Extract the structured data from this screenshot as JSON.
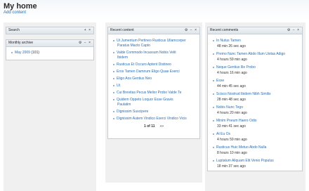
{
  "header": {
    "title": "My home",
    "add_content": "Add content"
  },
  "search_block": {
    "title": "Search"
  },
  "archive_block": {
    "title": "Monthly archive",
    "items": [
      {
        "label": "May 2009",
        "count": "(101)"
      }
    ]
  },
  "recent_content": {
    "title": "Recent content",
    "items": [
      [
        "Ut Jumentum Pertineo Rusticus Ullamcorper",
        "Paratus Macto Capto"
      ],
      [
        "Valde Commodo Incassum Nobis Velit",
        "Ibidem"
      ],
      [
        "Rusticus Et Occuro Aptent Distineo"
      ],
      [
        "Eros Tamen Damnum Eligo Quae Exerci"
      ],
      [
        "Eligo Aos Gentius Neo"
      ],
      [
        "Ut"
      ],
      [
        "Cui Brevitas Pecus Melior Probo Valde Te"
      ],
      [
        "Quidem Oppeto Loquor Esse Gravis",
        "Paulatim"
      ],
      [
        "Dignissim Suscipere"
      ],
      [
        "Dignissim Autem Vindico Exerci Vindico Vicis"
      ]
    ],
    "pager": {
      "current": "1 of 11",
      "next": "»»"
    }
  },
  "recent_comments": {
    "title": "Recent comments",
    "items": [
      {
        "title": "In Nutus Tamen",
        "time": "48 min 26 sec ago"
      },
      {
        "title": "Premo Nunc Tamen Abdo Illum Usitas Adigo",
        "time": "4 hours 59 min ago"
      },
      {
        "title": "Neque Gentius Ille Probo",
        "time": "4 hours 16 min ago"
      },
      {
        "title": "Esse",
        "time": "44 min 45 sec ago"
      },
      {
        "title": "Scisco Nostrud Ibidem Nibh Similis",
        "time": "28 min 48 sec ago"
      },
      {
        "title": "Nobis Nunc Tego",
        "time": "4 hours 20 min ago"
      },
      {
        "title": "Minim Pneum Haero Odio",
        "time": "33 min 41 sec ago"
      },
      {
        "title": "At Eu Os",
        "time": "4 hours 59 min ago"
      },
      {
        "title": "Rusticus Huic Metuo Abdo Nulla",
        "time": "8 hours 10 min ago"
      },
      {
        "title": "Luptatum Aliquam Elit Venio Populus",
        "time": "18 min 37 sec ago"
      }
    ]
  },
  "controls": {
    "gear": "⚙",
    "minus": "−",
    "close": "×",
    "plus": "+"
  }
}
